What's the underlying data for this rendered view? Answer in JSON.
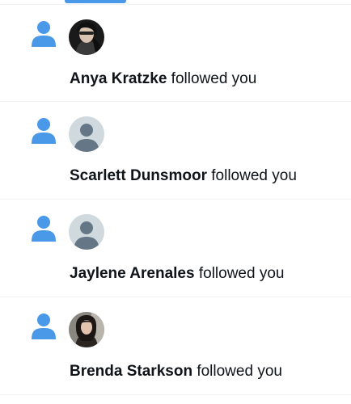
{
  "colors": {
    "accent": "#4a99e9",
    "text": "#0f1419",
    "divider": "#eff3f4",
    "default_avatar_bg": "#cfd9de",
    "default_avatar_fg": "#657786"
  },
  "notifications": [
    {
      "icon": "person-icon",
      "avatar": "photo-avatar",
      "name": "Anya Kratzke",
      "action": "followed you"
    },
    {
      "icon": "person-icon",
      "avatar": "default-avatar",
      "name": "Scarlett Dunsmoor",
      "action": "followed you"
    },
    {
      "icon": "person-icon",
      "avatar": "default-avatar",
      "name": "Jaylene Arenales",
      "action": "followed you"
    },
    {
      "icon": "person-icon",
      "avatar": "photo-avatar",
      "name": "Brenda Starkson",
      "action": "followed you"
    }
  ]
}
